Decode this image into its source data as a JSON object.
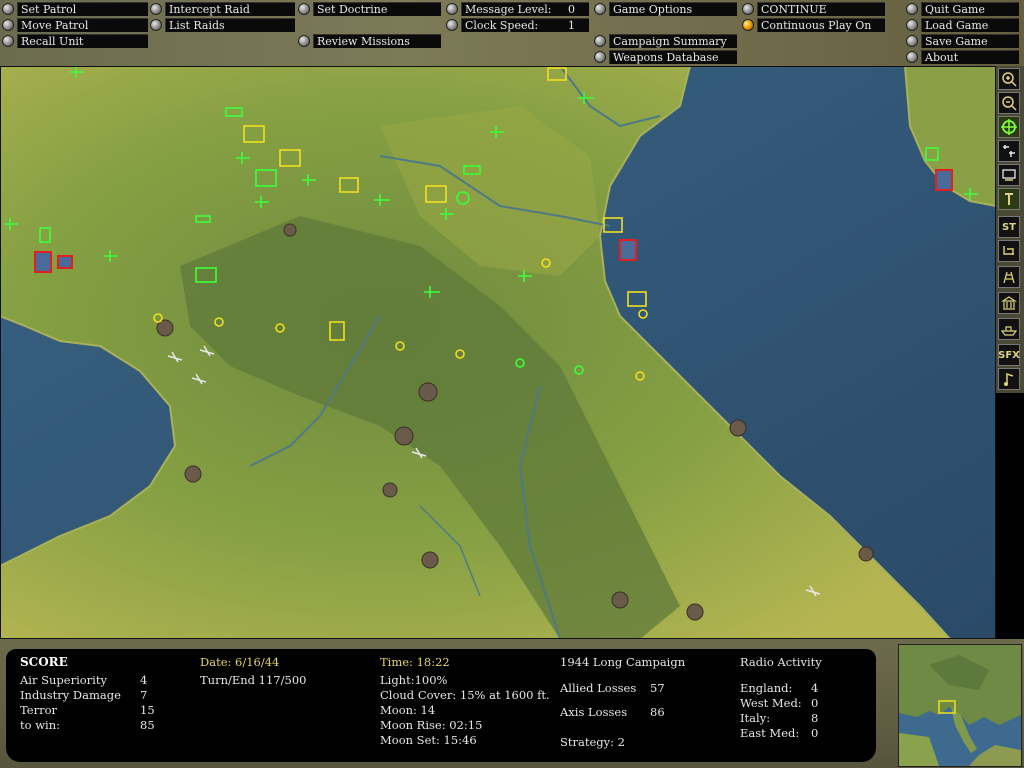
{
  "menu": {
    "col1": [
      "Set Patrol",
      "Move Patrol",
      "Recall Unit"
    ],
    "col2": [
      "Intercept Raid",
      "List Raids"
    ],
    "col3": [
      "Set Doctrine",
      "Review Missions"
    ],
    "col4": [
      {
        "label": "Message Level:",
        "value": "0"
      },
      {
        "label": "Clock Speed:",
        "value": "1"
      }
    ],
    "col5": [
      "Game Options",
      "Campaign Summary",
      "Weapons Database"
    ],
    "col6": [
      "CONTINUE",
      "Continuous Play On"
    ],
    "col7": [
      "Quit Game",
      "Load Game",
      "Save Game",
      "About"
    ]
  },
  "toolbar": {
    "buttons": [
      {
        "name": "zoom-in-icon"
      },
      {
        "name": "zoom-out-icon"
      },
      {
        "name": "target-icon"
      },
      {
        "name": "aircraft-filter-icon"
      },
      {
        "name": "ground-filter-icon"
      },
      {
        "name": "tower-icon"
      },
      {
        "label": "ST"
      },
      {
        "name": "network-icon"
      },
      {
        "name": "building-icon"
      },
      {
        "name": "factory-icon"
      },
      {
        "name": "ship-icon"
      },
      {
        "label": "SFX"
      },
      {
        "name": "music-note-icon"
      }
    ]
  },
  "score": {
    "title": "SCORE",
    "rows": [
      {
        "label": "Air Superiority",
        "value": "4"
      },
      {
        "label": "Industry Damage",
        "value": "7"
      },
      {
        "label": "Terror",
        "value": "15"
      },
      {
        "label": "to win:",
        "value": "85"
      }
    ]
  },
  "date": {
    "date": "Date: 6/16/44",
    "turn": "Turn/End 117/500"
  },
  "time": {
    "time": "Time: 18:22",
    "light": "Light:100%",
    "cloud": "Cloud Cover: 15% at 1600 ft.",
    "moon": "Moon: 14",
    "moonrise": "Moon Rise: 02:15",
    "moonset": "Moon Set: 15:46"
  },
  "campaign": {
    "title": "1944 Long Campaign",
    "allied_label": "Allied Losses",
    "allied_value": "57",
    "axis_label": "Axis Losses",
    "axis_value": "86",
    "strategy": "Strategy: 2"
  },
  "radio": {
    "title": "Radio Activity",
    "rows": [
      {
        "label": "England:",
        "value": "4"
      },
      {
        "label": "West Med:",
        "value": "0"
      },
      {
        "label": "Italy:",
        "value": "8"
      },
      {
        "label": "East Med:",
        "value": "0"
      }
    ]
  },
  "colors": {
    "allied_unit": "#3cff3c",
    "axis_unit": "#f0e020",
    "target": "#e02020",
    "sea": "#2f5373",
    "land": "#7f9a3c"
  }
}
